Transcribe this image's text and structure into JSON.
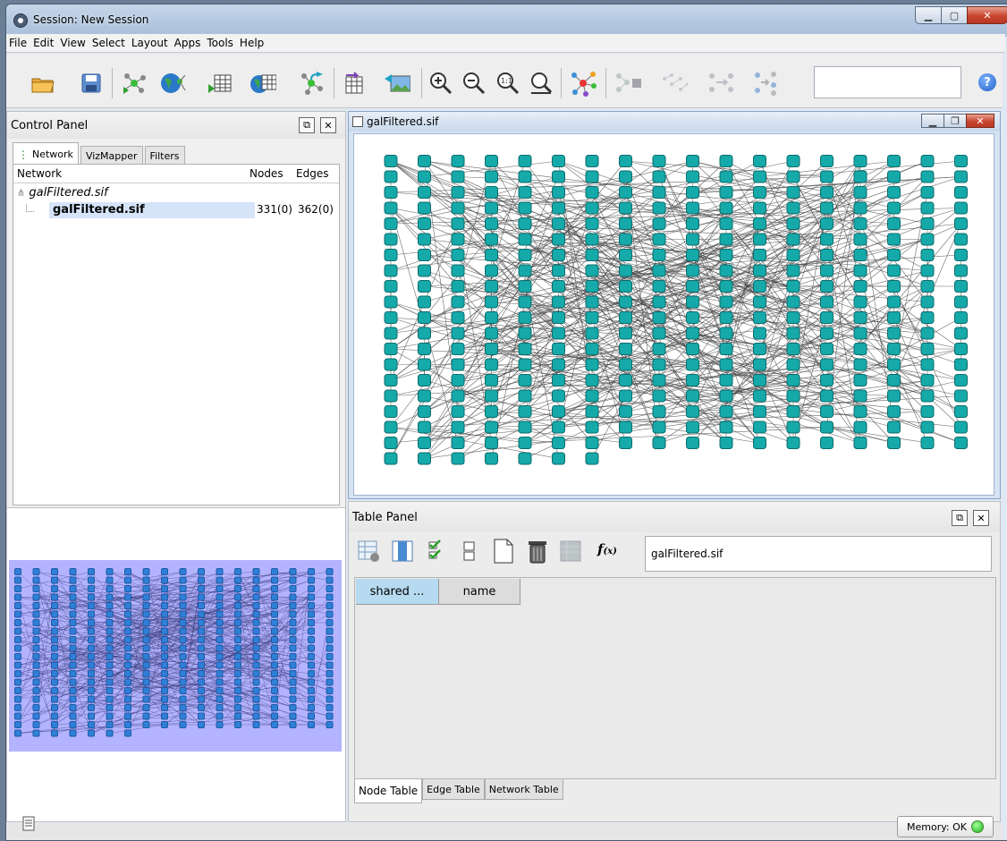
{
  "window": {
    "title": "Session: New Session"
  },
  "menu": [
    "File",
    "Edit",
    "View",
    "Select",
    "Layout",
    "Apps",
    "Tools",
    "Help"
  ],
  "control_panel": {
    "title": "Control Panel",
    "tabs": [
      "Network",
      "VizMapper",
      "Filters"
    ],
    "active_tab": "Network",
    "columns": {
      "network": "Network",
      "nodes": "Nodes",
      "edges": "Edges"
    },
    "root": "galFiltered.sif",
    "rows": [
      {
        "name": "galFiltered.sif",
        "nodes": "331(0)",
        "edges": "362(0)"
      }
    ]
  },
  "network_view": {
    "title": "galFiltered.sif"
  },
  "table_panel": {
    "title": "Table Panel",
    "network_field": "galFiltered.sif",
    "columns": [
      "shared ...",
      "name"
    ],
    "tabs": [
      "Node Table",
      "Edge Table",
      "Network Table"
    ],
    "active_tab": "Node Table"
  },
  "status": {
    "memory": "Memory: OK"
  },
  "colors": {
    "node_fill": "#16a9a9",
    "node_border": "#0e6b6b",
    "edge": "#444444",
    "birdseye_bg": "#b3b3ff",
    "birdseye_node": "#2f7fd6"
  }
}
